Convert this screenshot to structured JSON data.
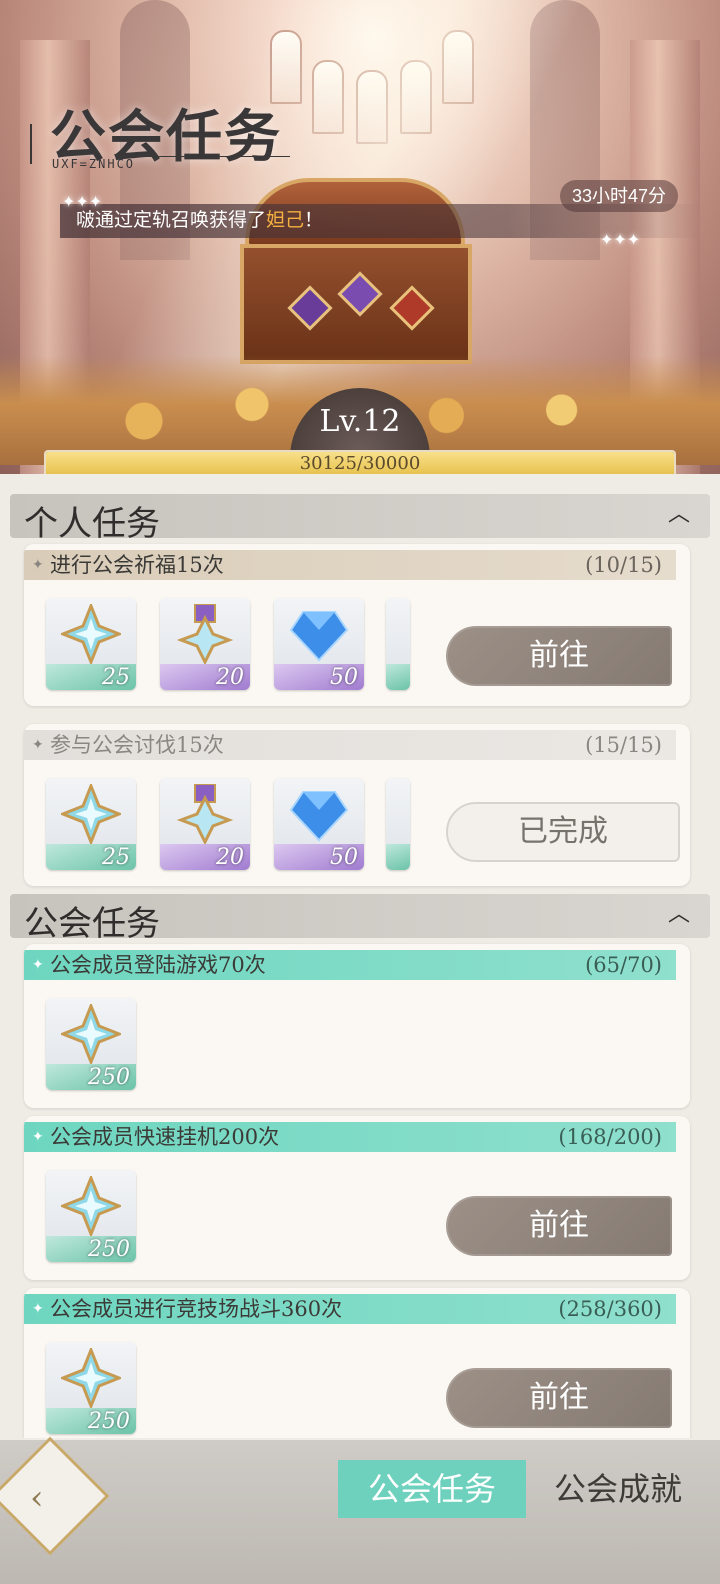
{
  "header": {
    "title": "公会任务",
    "subtitle": "UXF=ZNHCO",
    "timer": "33小时47分",
    "notice_prefix": "啵通过定轨召唤获得了",
    "notice_highlight": "妲己",
    "notice_suffix": "！",
    "level": "Lv.12",
    "exp_text": "30125/30000",
    "exp_fraction": 1.0
  },
  "sections": {
    "personal": {
      "title": "个人任务"
    },
    "guild": {
      "title": "公会任务"
    }
  },
  "personal_tasks": [
    {
      "name": "进行公会祈福15次",
      "progress": "(10/15)",
      "rewards": [
        {
          "icon": "star-crystal-icon",
          "qty": "25"
        },
        {
          "icon": "medal-icon",
          "qty": "20"
        },
        {
          "icon": "diamond-icon",
          "qty": "50"
        }
      ],
      "button": "前往"
    },
    {
      "name": "参与公会讨伐15次",
      "progress": "(15/15)",
      "rewards": [
        {
          "icon": "star-crystal-icon",
          "qty": "25"
        },
        {
          "icon": "medal-icon",
          "qty": "20"
        },
        {
          "icon": "diamond-icon",
          "qty": "50"
        }
      ],
      "button": "已完成"
    }
  ],
  "guild_tasks": [
    {
      "name": "公会成员登陆游戏70次",
      "progress": "(65/70)",
      "rewards": [
        {
          "icon": "star-crystal-icon",
          "qty": "250"
        }
      ]
    },
    {
      "name": "公会成员快速挂机200次",
      "progress": "(168/200)",
      "rewards": [
        {
          "icon": "star-crystal-icon",
          "qty": "250"
        }
      ],
      "button": "前往"
    },
    {
      "name": "公会成员进行竞技场战斗360次",
      "progress": "(258/360)",
      "rewards": [
        {
          "icon": "star-crystal-icon",
          "qty": "250"
        }
      ],
      "button": "前往"
    }
  ],
  "footer": {
    "tab_active": "公会任务",
    "tab_inactive": "公会成就"
  }
}
